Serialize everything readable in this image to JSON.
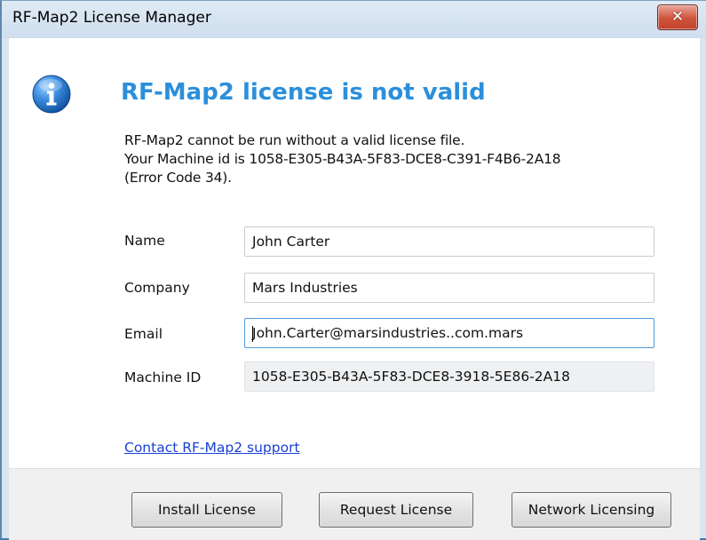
{
  "window": {
    "title": "RF-Map2 License Manager",
    "close_glyph": "✕"
  },
  "message": {
    "icon": "info-icon",
    "heading": "RF-Map2 license is not valid",
    "lines": [
      "RF-Map2 cannot be run without a valid license file.",
      "Your Machine id is 1058-E305-B43A-5F83-DCE8-C391-F4B6-2A18",
      "(Error Code 34)."
    ]
  },
  "form": {
    "name_label": "Name",
    "name_value": "John Carter",
    "company_label": "Company",
    "company_value": "Mars Industries",
    "email_label": "Email",
    "email_value": "John.Carter@marsindustries..com.mars",
    "machine_id_label": "Machine ID",
    "machine_id_value": "1058-E305-B43A-5F83-DCE8-3918-5E86-2A18"
  },
  "support_link": "Contact RF-Map2 support",
  "buttons": {
    "install": "Install License",
    "request": "Request License",
    "network": "Network Licensing"
  },
  "colors": {
    "heading": "#2b8fdb",
    "link": "#1a3fd6",
    "close_button": "#c2432c",
    "info_icon": "#1f6fc4"
  }
}
